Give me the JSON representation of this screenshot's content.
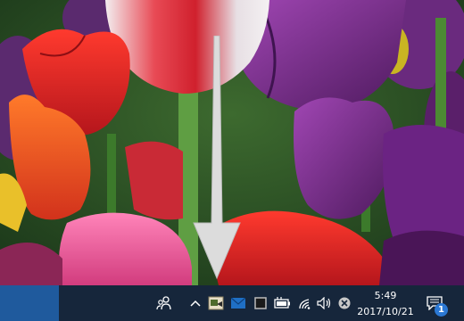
{
  "taskbar": {
    "clock_time": "5:49",
    "clock_date": "2017/10/21",
    "notification_count": "1",
    "start_color": "#1f5a9d",
    "bar_color": "#16263b"
  },
  "tray_icons": [
    "people-icon",
    "show-hidden-chevron-icon",
    "app-tray-icon",
    "mail-icon",
    "square-app-icon",
    "battery-icon",
    "wifi-icon",
    "volume-icon",
    "close-circle-icon",
    "action-center-icon"
  ],
  "wallpaper": {
    "subject": "tulips",
    "colors": [
      "#c21f2a",
      "#7a2a8c",
      "#2f6b2c",
      "#f06aa0"
    ]
  },
  "overlay": {
    "arrow_color": "#dcdcdc"
  }
}
